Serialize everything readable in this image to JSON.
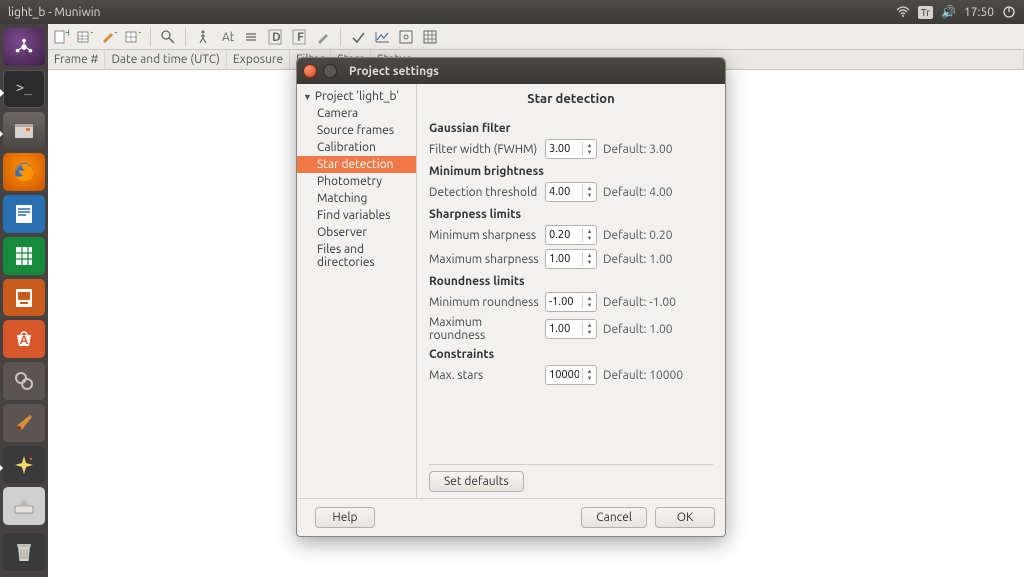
{
  "panel": {
    "window_title": "light_b - Muniwin",
    "keyboard": "Tr",
    "time": "17:50"
  },
  "launcher": {
    "items": [
      {
        "name": "dash",
        "glyph": ""
      },
      {
        "name": "terminal",
        "glyph": ">_"
      },
      {
        "name": "files",
        "glyph": "🗀"
      },
      {
        "name": "firefox",
        "glyph": ""
      },
      {
        "name": "writer",
        "glyph": "✎"
      },
      {
        "name": "calc",
        "glyph": "▦"
      },
      {
        "name": "impress",
        "glyph": "▭"
      },
      {
        "name": "software",
        "glyph": "A"
      },
      {
        "name": "settings",
        "glyph": "⚙"
      },
      {
        "name": "brush",
        "glyph": "🖌"
      },
      {
        "name": "star-app",
        "glyph": "✦"
      },
      {
        "name": "drive",
        "glyph": "⏏"
      },
      {
        "name": "trash",
        "glyph": "🗑"
      }
    ]
  },
  "toolbar_icons": [
    "➕",
    "▦+",
    "✎+",
    "▦+",
    "🔍",
    "🚶",
    "🔠",
    "▤",
    "D",
    "F",
    "✎",
    "✔",
    "📈",
    "🔳",
    "▦"
  ],
  "columns": [
    "Frame #",
    "Date and time (UTC)",
    "Exposure",
    "Filter",
    "Stars",
    "Status"
  ],
  "dialog": {
    "title": "Project settings",
    "tree_root": "Project 'light_b'",
    "tree_items": [
      "Camera",
      "Source frames",
      "Calibration",
      "Star detection",
      "Photometry",
      "Matching",
      "Find variables",
      "Observer",
      "Files and directories"
    ],
    "tree_selected_index": 3,
    "panel_title": "Star detection",
    "groups": {
      "gaussian": {
        "heading": "Gaussian filter",
        "rows": [
          {
            "label": "Filter width (FWHM)",
            "value": "3.00",
            "default": "Default: 3.00"
          }
        ]
      },
      "minbright": {
        "heading": "Minimum brightness",
        "rows": [
          {
            "label": "Detection threshold",
            "value": "4.00",
            "default": "Default: 4.00"
          }
        ]
      },
      "sharp": {
        "heading": "Sharpness limits",
        "rows": [
          {
            "label": "Minimum sharpness",
            "value": "0.20",
            "default": "Default: 0.20"
          },
          {
            "label": "Maximum sharpness",
            "value": "1.00",
            "default": "Default: 1.00"
          }
        ]
      },
      "round": {
        "heading": "Roundness limits",
        "rows": [
          {
            "label": "Minimum roundness",
            "value": "-1.00",
            "default": "Default: -1.00"
          },
          {
            "label": "Maximum roundness",
            "value": "1.00",
            "default": "Default: 1.00"
          }
        ]
      },
      "constraints": {
        "heading": "Constraints",
        "rows": [
          {
            "label": "Max. stars",
            "value": "10000",
            "default": "Default: 10000"
          }
        ]
      }
    },
    "set_defaults": "Set defaults",
    "help": "Help",
    "cancel": "Cancel",
    "ok": "OK"
  }
}
